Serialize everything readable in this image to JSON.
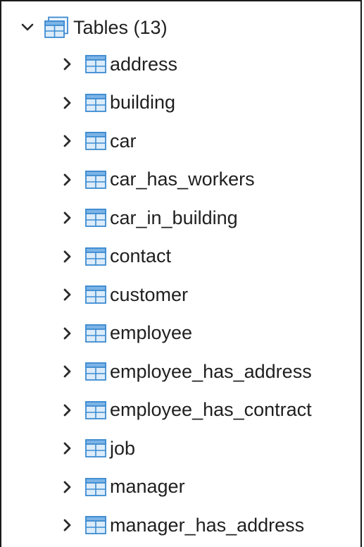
{
  "tree": {
    "root": {
      "label": "Tables (13)",
      "expanded": true,
      "icon": "tables-group-icon"
    },
    "items": [
      {
        "label": "address"
      },
      {
        "label": "building"
      },
      {
        "label": "car"
      },
      {
        "label": "car_has_workers"
      },
      {
        "label": "car_in_building"
      },
      {
        "label": "contact"
      },
      {
        "label": "customer"
      },
      {
        "label": "employee"
      },
      {
        "label": "employee_has_address"
      },
      {
        "label": "employee_has_contract"
      },
      {
        "label": "job"
      },
      {
        "label": "manager"
      },
      {
        "label": "manager_has_address"
      }
    ],
    "colors": {
      "icon_stroke": "#3d8bd1",
      "icon_fill": "#dcecfa",
      "icon_header": "#7db4e6",
      "text": "#1f1f1f",
      "chevron": "#2a2a2a"
    }
  }
}
